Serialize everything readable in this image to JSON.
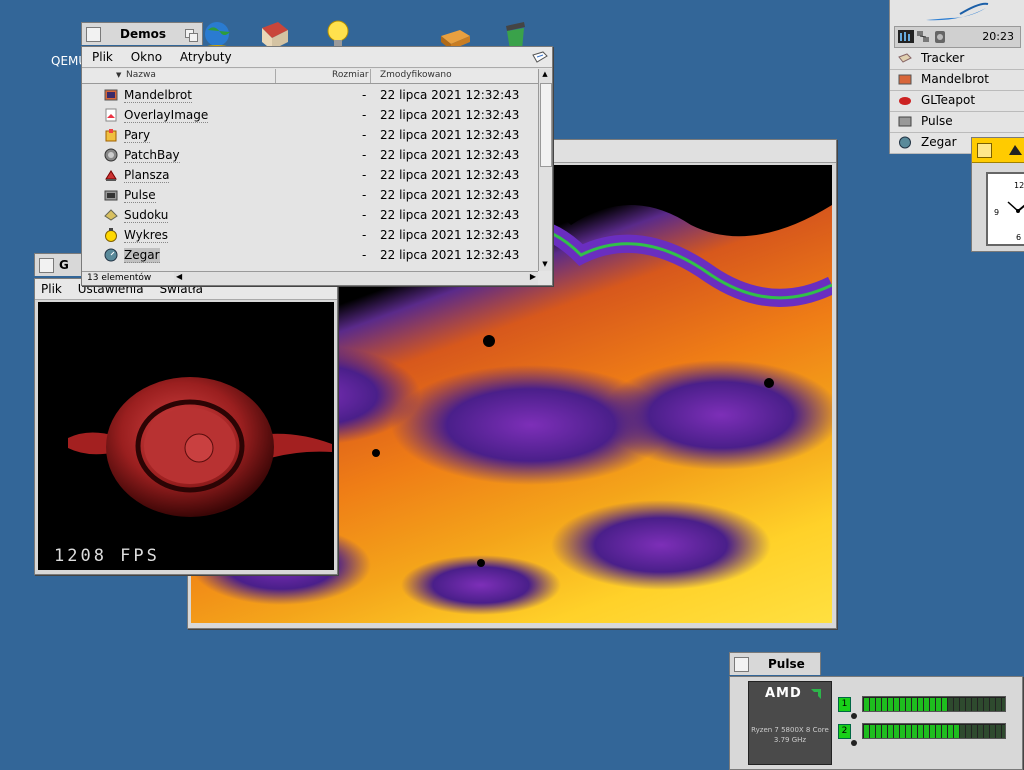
{
  "desktop": {
    "qemu_label": "QEMU"
  },
  "demos_window": {
    "title": "Demos",
    "menu": [
      "Plik",
      "Okno",
      "Atrybuty"
    ],
    "columns": {
      "name": "Nazwa",
      "size": "Rozmiar",
      "modified": "Zmodyfikowano"
    },
    "rows": [
      {
        "name": "Mandelbrot",
        "size": "-",
        "modified": "22 lipca 2021 12:32:43",
        "icon": "mandelbrot-icon"
      },
      {
        "name": "OverlayImage",
        "size": "-",
        "modified": "22 lipca 2021 12:32:43",
        "icon": "overlay-icon"
      },
      {
        "name": "Pary",
        "size": "-",
        "modified": "22 lipca 2021 12:32:43",
        "icon": "pary-icon"
      },
      {
        "name": "PatchBay",
        "size": "-",
        "modified": "22 lipca 2021 12:32:43",
        "icon": "patchbay-icon"
      },
      {
        "name": "Plansza",
        "size": "-",
        "modified": "22 lipca 2021 12:32:43",
        "icon": "plansza-icon"
      },
      {
        "name": "Pulse",
        "size": "-",
        "modified": "22 lipca 2021 12:32:43",
        "icon": "pulse-icon"
      },
      {
        "name": "Sudoku",
        "size": "-",
        "modified": "22 lipca 2021 12:32:43",
        "icon": "sudoku-icon"
      },
      {
        "name": "Wykres",
        "size": "-",
        "modified": "22 lipca 2021 12:32:43",
        "icon": "wykres-icon"
      },
      {
        "name": "Zegar",
        "size": "-",
        "modified": "22 lipca 2021 12:32:43",
        "icon": "zegar-icon"
      }
    ],
    "status": "13 elementów"
  },
  "glteapot_window": {
    "title": "G",
    "menu": [
      "Plik",
      "Ustawienia",
      "Światła"
    ],
    "fps": "1208 FPS"
  },
  "deskbar": {
    "clock": "20:23",
    "apps": [
      "Tracker",
      "Mandelbrot",
      "GLTeapot",
      "Pulse",
      "Zegar"
    ]
  },
  "pulse_window": {
    "title": "Pulse",
    "cpu_brand": "AMD",
    "cpu_name": "Ryzen 7 5800X 8 Core",
    "cpu_freq": "3.79 GHz",
    "cores": [
      {
        "label": "1",
        "load": 0.6
      },
      {
        "label": "2",
        "load": 0.65
      }
    ]
  },
  "colors": {
    "desktop": "#336698",
    "window": "#d8d8d8",
    "accent": "#ffcb00"
  }
}
